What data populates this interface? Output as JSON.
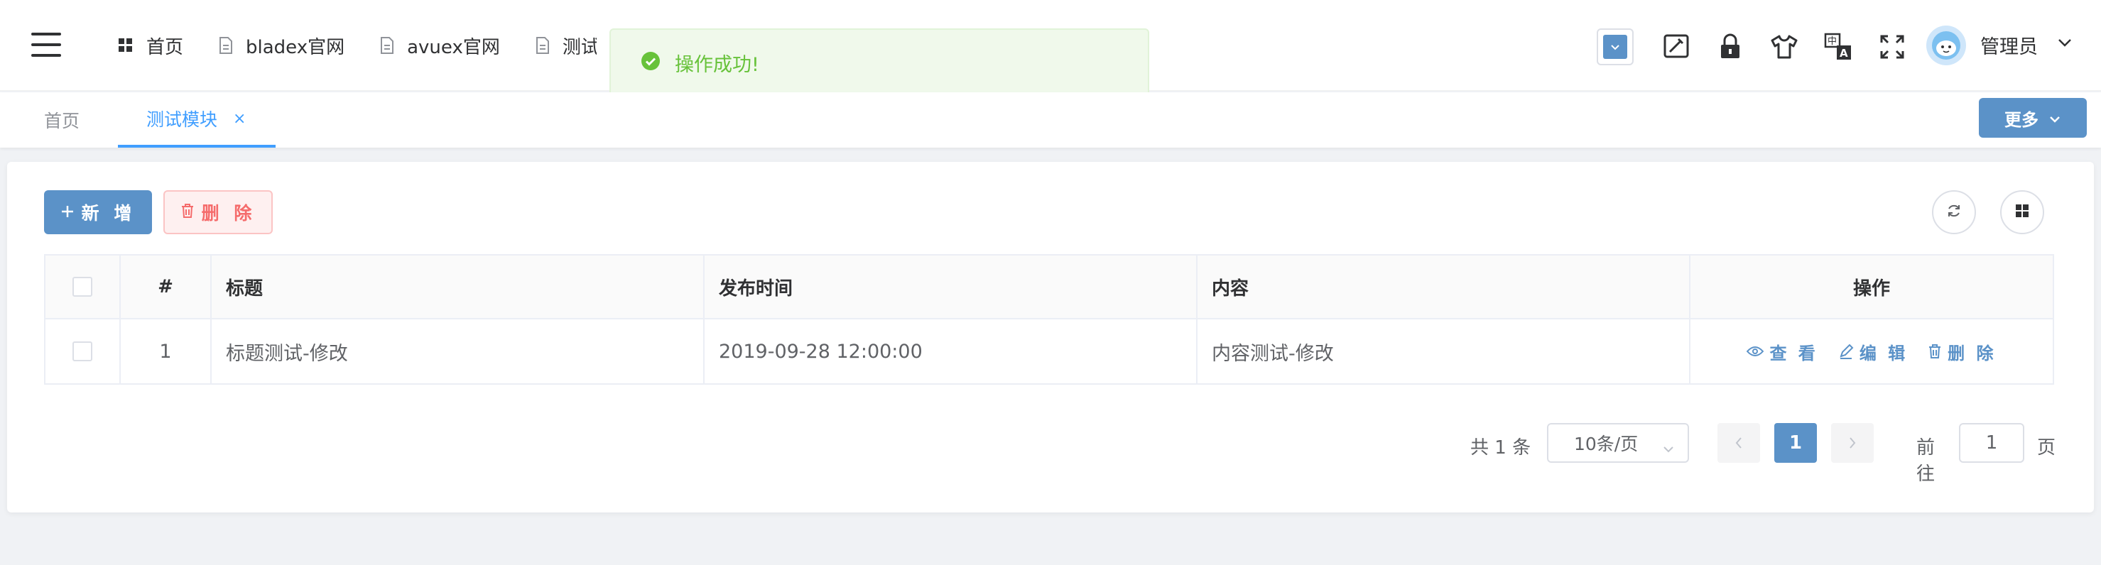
{
  "nav": {
    "items": [
      {
        "label": "首页",
        "icon": "grid-icon"
      },
      {
        "label": "bladex官网",
        "icon": "document-icon"
      },
      {
        "label": "avuex官网",
        "icon": "document-icon"
      },
      {
        "label": "测试模块",
        "icon": "document-icon"
      }
    ]
  },
  "toast": {
    "message": "操作成功!",
    "icon": "check-circle-icon",
    "color": "#67c23a"
  },
  "user": {
    "name": "管理员"
  },
  "tabs": {
    "home": "首页",
    "active": "测试模块",
    "close": "×",
    "more": "更多"
  },
  "toolbar": {
    "add_label": "新 增",
    "delete_label": "删 除"
  },
  "table": {
    "columns": [
      "#",
      "标题",
      "发布时间",
      "内容",
      "操作"
    ],
    "rows": [
      {
        "index": "1",
        "title": "标题测试-修改",
        "time": "2019-09-28 12:00:00",
        "content": "内容测试-修改"
      }
    ],
    "ops": {
      "view": "查 看",
      "edit": "编 辑",
      "delete": "删 除"
    }
  },
  "pagination": {
    "total": "共 1 条",
    "page_size": "10条/页",
    "current_page": "1",
    "goto_prefix": "前往",
    "goto_value": "1",
    "goto_suffix": "页"
  },
  "colors": {
    "primary": "#5b92c8",
    "success": "#67c23a",
    "danger": "#f56c6c"
  }
}
